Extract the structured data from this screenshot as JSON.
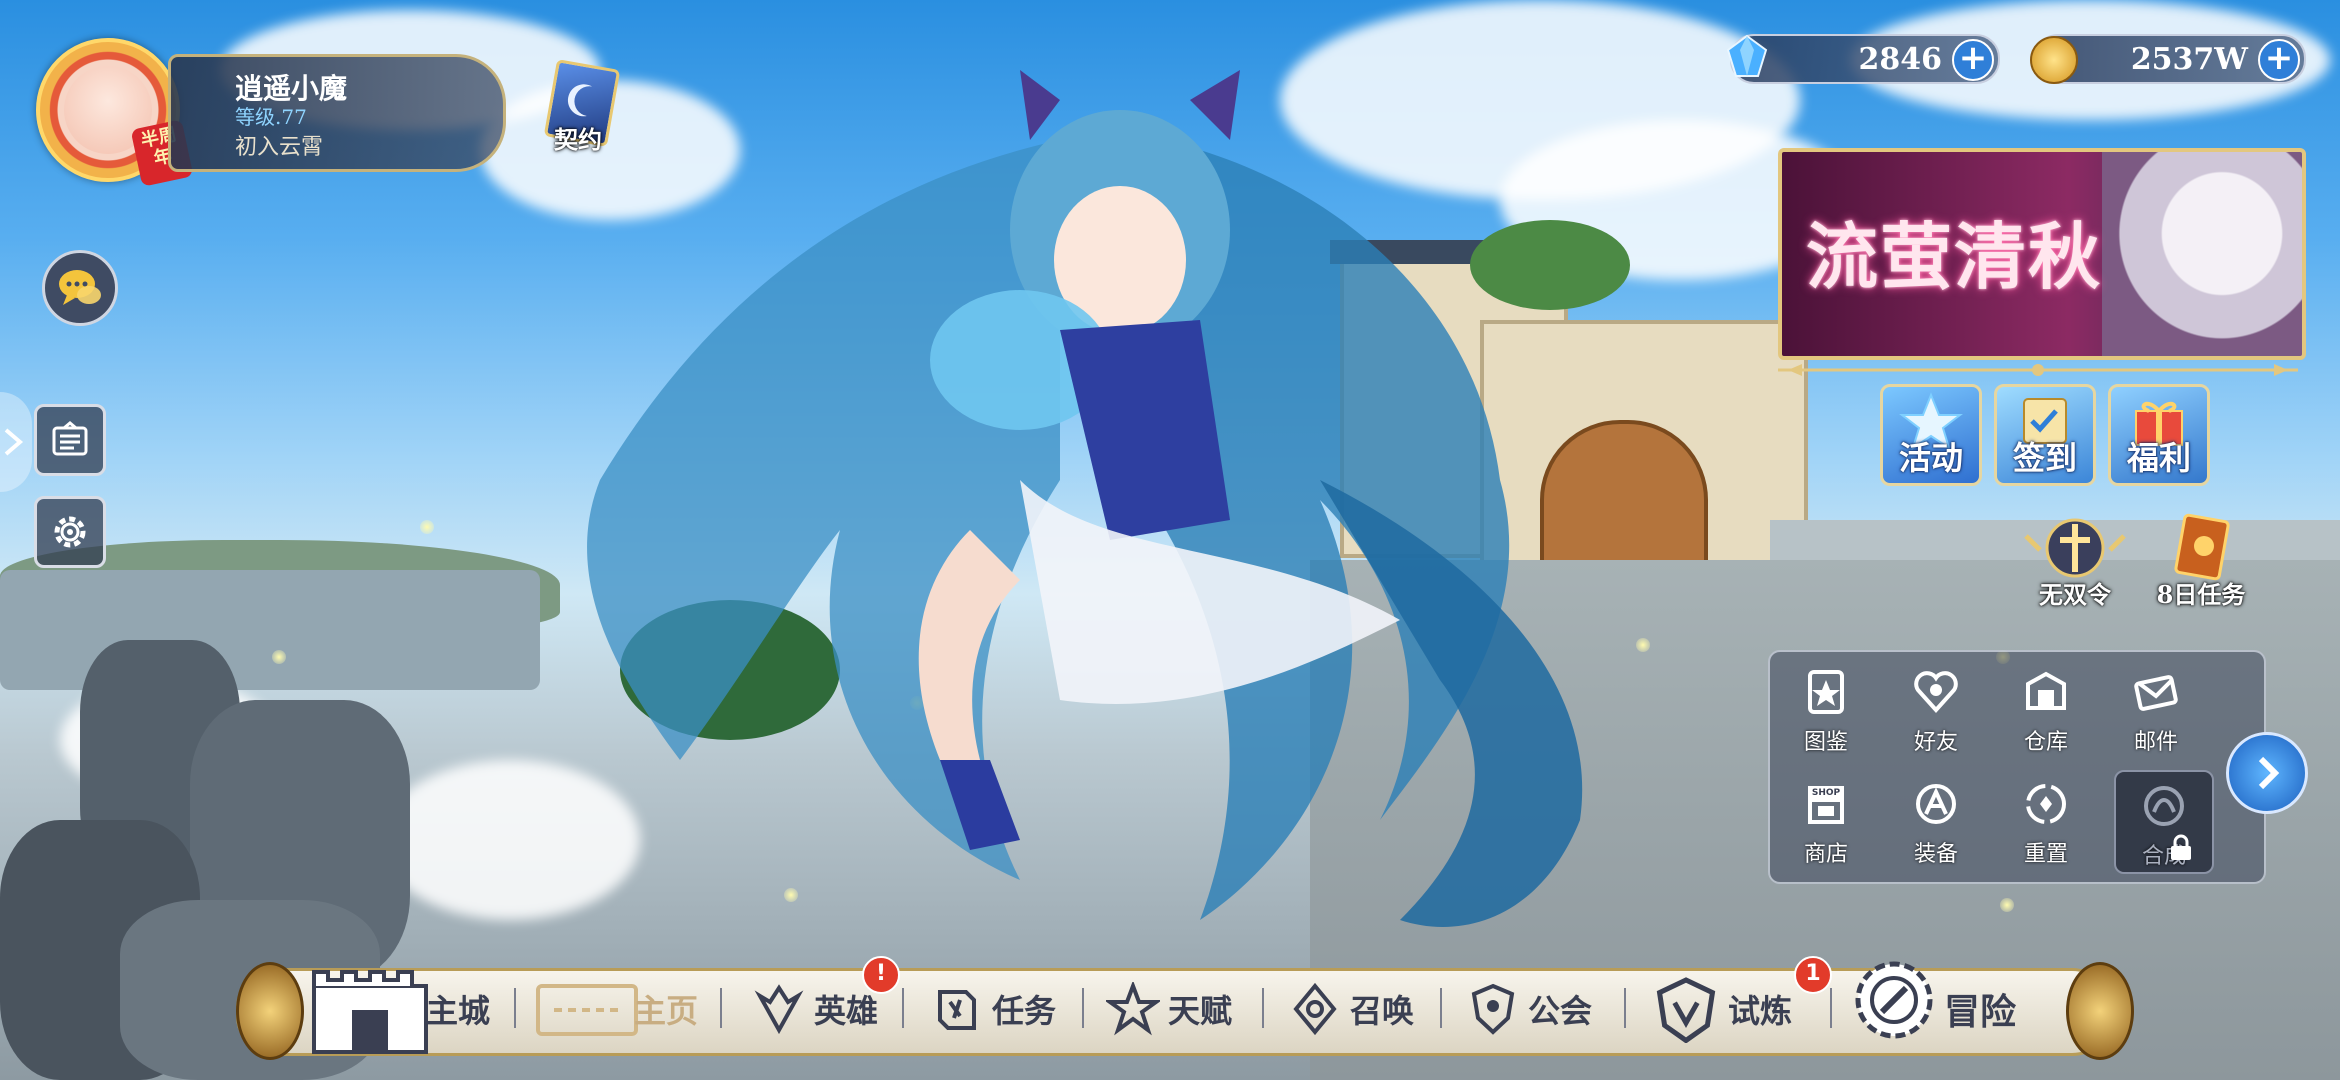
{
  "player": {
    "name": "逍遥小魔",
    "level": "等级.77",
    "title": "初入云霄",
    "avatar_badge": "半周年"
  },
  "contract": {
    "label": "契约"
  },
  "currencies": {
    "gems": "2846",
    "gold": "2537W"
  },
  "banner": {
    "title": "流萤清秋"
  },
  "event_buttons": [
    {
      "label": "活动",
      "icon": "star-icon"
    },
    {
      "label": "签到",
      "icon": "check-in-icon"
    },
    {
      "label": "福利",
      "icon": "gift-icon"
    }
  ],
  "features": [
    {
      "label": "无双令",
      "icon": "sword-emblem-icon"
    },
    {
      "label": "8日任务",
      "icon": "book-icon"
    }
  ],
  "functions": [
    {
      "label": "图鉴",
      "icon": "codex-icon"
    },
    {
      "label": "好友",
      "icon": "friends-icon"
    },
    {
      "label": "仓库",
      "icon": "warehouse-icon"
    },
    {
      "label": "邮件",
      "icon": "mail-icon"
    },
    {
      "label": "商店",
      "icon": "shop-icon",
      "sign": "SHOP"
    },
    {
      "label": "装备",
      "icon": "equipment-icon"
    },
    {
      "label": "重置",
      "icon": "reset-icon"
    },
    {
      "label": "合成",
      "icon": "synthesis-icon",
      "locked": true
    }
  ],
  "nav": {
    "main_city": "主城",
    "home": "主页",
    "heroes": "英雄",
    "quests": "任务",
    "talent": "天赋",
    "summon": "召唤",
    "guild": "公会",
    "trial": "试炼",
    "adventure": "冒险",
    "heroes_badge": "!",
    "trial_badge": "1"
  },
  "colors": {
    "accent_blue": "#2f7fd8",
    "gold_trim": "#b89c57",
    "badge_red": "#e23b2a",
    "banner_magenta": "#8c2a63"
  }
}
